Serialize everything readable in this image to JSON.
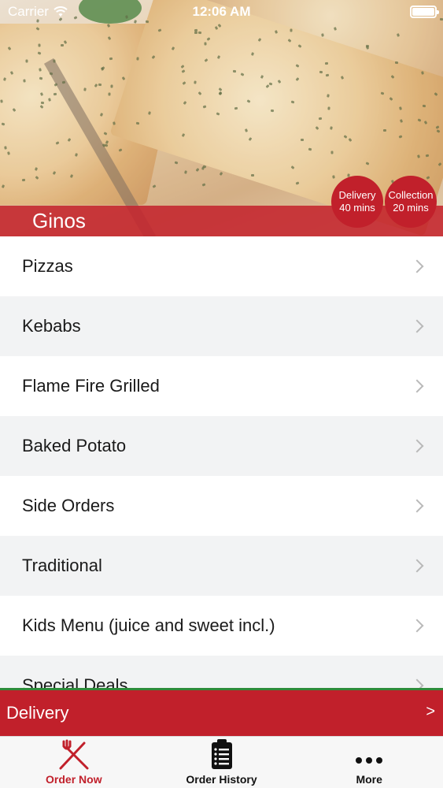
{
  "status_bar": {
    "carrier": "Carrier",
    "time": "12:06 AM"
  },
  "restaurant": {
    "name": "Ginos"
  },
  "badges": {
    "delivery": {
      "label": "Delivery",
      "time": "40 mins"
    },
    "collection": {
      "label": "Collection",
      "time": "20 mins"
    }
  },
  "menu": {
    "items": [
      {
        "label": "Pizzas"
      },
      {
        "label": "Kebabs"
      },
      {
        "label": "Flame Fire Grilled"
      },
      {
        "label": "Baked Potato"
      },
      {
        "label": "Side Orders"
      },
      {
        "label": "Traditional"
      },
      {
        "label": "Kids Menu (juice and sweet incl.)"
      },
      {
        "label": "Special Deals"
      }
    ]
  },
  "order_bar": {
    "label": "Delivery",
    "arrow": ">"
  },
  "tabs": [
    {
      "label": "Order Now",
      "icon": "fork-knife-icon",
      "active": true
    },
    {
      "label": "Order History",
      "icon": "clipboard-list-icon",
      "active": false
    },
    {
      "label": "More",
      "icon": "more-dots-icon",
      "active": false
    }
  ],
  "colors": {
    "brand_red": "#c1202b",
    "accent_green": "#2e8b3a"
  }
}
